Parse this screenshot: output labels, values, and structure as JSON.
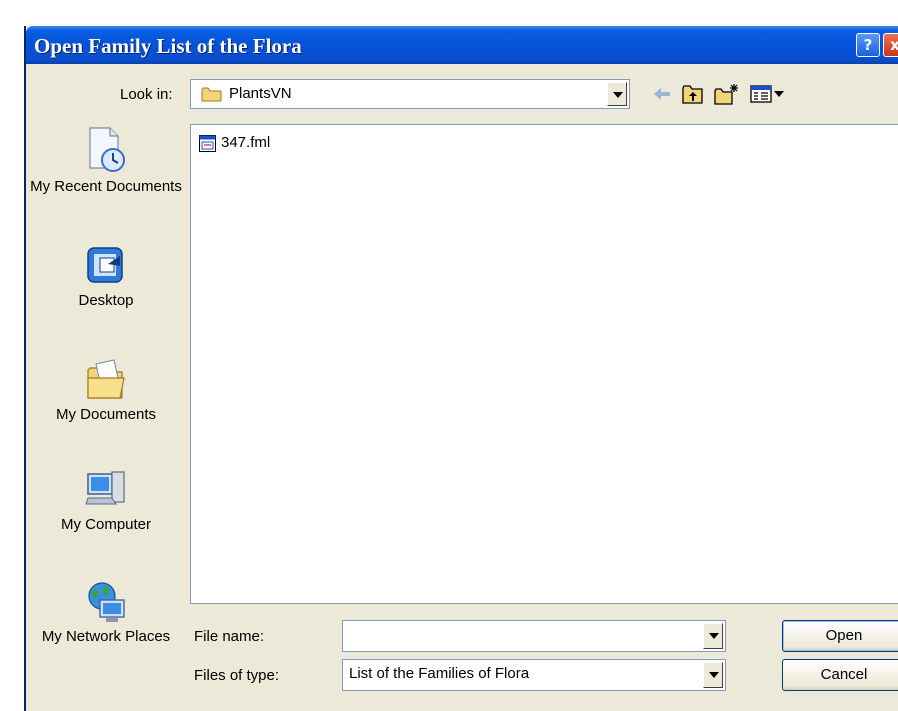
{
  "window": {
    "title": "Open Family List of the Flora",
    "help_icon": "?",
    "close_icon": "x"
  },
  "toolbar": {
    "look_in_label": "Look in:",
    "look_in_value": "PlantsVN",
    "icons": [
      "back-arrow-icon",
      "up-one-level-icon",
      "new-folder-icon",
      "view-menu-icon"
    ]
  },
  "places": [
    {
      "label": "My Recent Documents",
      "icon": "recent-documents-icon"
    },
    {
      "label": "Desktop",
      "icon": "desktop-icon"
    },
    {
      "label": "My Documents",
      "icon": "my-documents-icon"
    },
    {
      "label": "My Computer",
      "icon": "my-computer-icon"
    },
    {
      "label": "My Network Places",
      "icon": "network-places-icon"
    }
  ],
  "files": [
    {
      "name": "347.fml",
      "icon": "fml-file-icon"
    }
  ],
  "form": {
    "file_name_label": "File name:",
    "file_name_value": "",
    "file_type_label": "Files of type:",
    "file_type_value": "List of the Families of Flora"
  },
  "buttons": {
    "open": "Open",
    "cancel": "Cancel"
  },
  "colors": {
    "titlebar": "#0452d8",
    "dialog_bg": "#ece9d8",
    "field_border": "#7f9db9"
  }
}
